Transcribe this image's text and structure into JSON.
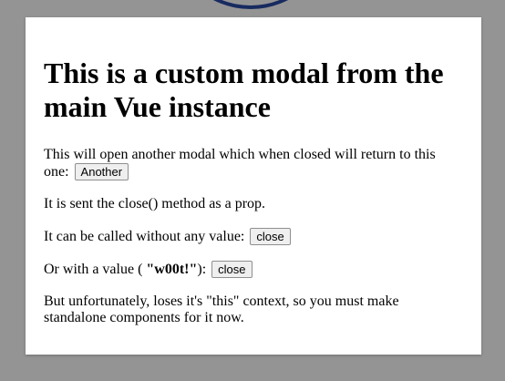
{
  "modal": {
    "title": "This is a custom modal from the main Vue instance",
    "para1_text": "This will open another modal which when closed will return to this one:",
    "another_button": "Another",
    "para2_text": "It is sent the close() method as a prop.",
    "para3_text": "It can be called without any value:",
    "close_button_1": "close",
    "para4_prefix": "Or with a value ( ",
    "para4_value": "\"w00t!\"",
    "para4_suffix": "):",
    "close_button_2": "close",
    "para5_text": "But unfortunately, loses it's \"this\" context, so you must make standalone components for it now."
  },
  "colors": {
    "overlay": "#6b6b6b",
    "background_circle": "#2a4aa6"
  }
}
